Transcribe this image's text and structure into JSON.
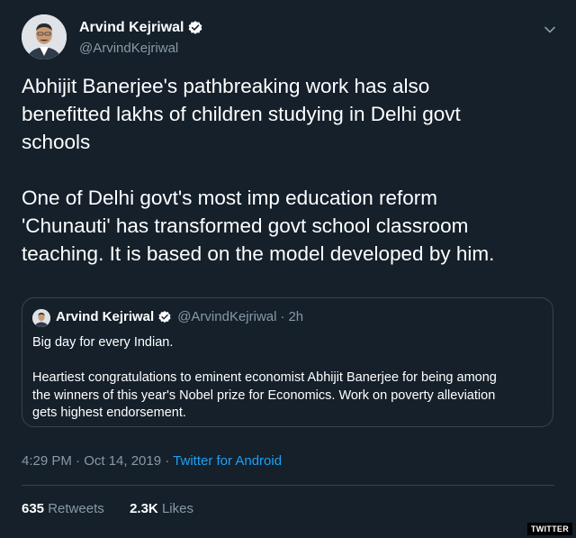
{
  "author": {
    "name": "Arvind Kejriwal",
    "handle": "@ArvindKejriwal",
    "verified": true
  },
  "tweet": {
    "text": "Abhijit Banerjee's pathbreaking work has also\nbenefitted lakhs of children studying in Delhi govt\nschools\n\nOne of Delhi govt's most imp education reform\n'Chunauti' has transformed govt school classroom\nteaching. It is based on the model developed by him."
  },
  "quoted_tweet": {
    "name": "Arvind Kejriwal",
    "handle": "@ArvindKejriwal",
    "separator": "·",
    "time": "2h",
    "text": "Big day for every Indian.\n\nHeartiest congratulations to eminent economist Abhijit Banerjee for being among\nthe winners of this year's Nobel prize for Economics. Work on poverty alleviation\ngets highest endorsement."
  },
  "meta": {
    "timestamp": "4:29 PM · Oct 14, 2019 ·",
    "source": "Twitter for Android"
  },
  "stats": {
    "retweets_count": "635",
    "retweets_label": "Retweets",
    "likes_count": "2.3K",
    "likes_label": "Likes"
  },
  "watermark": "TWITTER",
  "colors": {
    "background": "#15202b",
    "text": "#ffffff",
    "secondary": "#8899a6",
    "accent": "#1da1f2",
    "border": "#38444d"
  },
  "icons": {
    "verified": "verified-badge-icon",
    "chevron": "chevron-down-icon"
  }
}
